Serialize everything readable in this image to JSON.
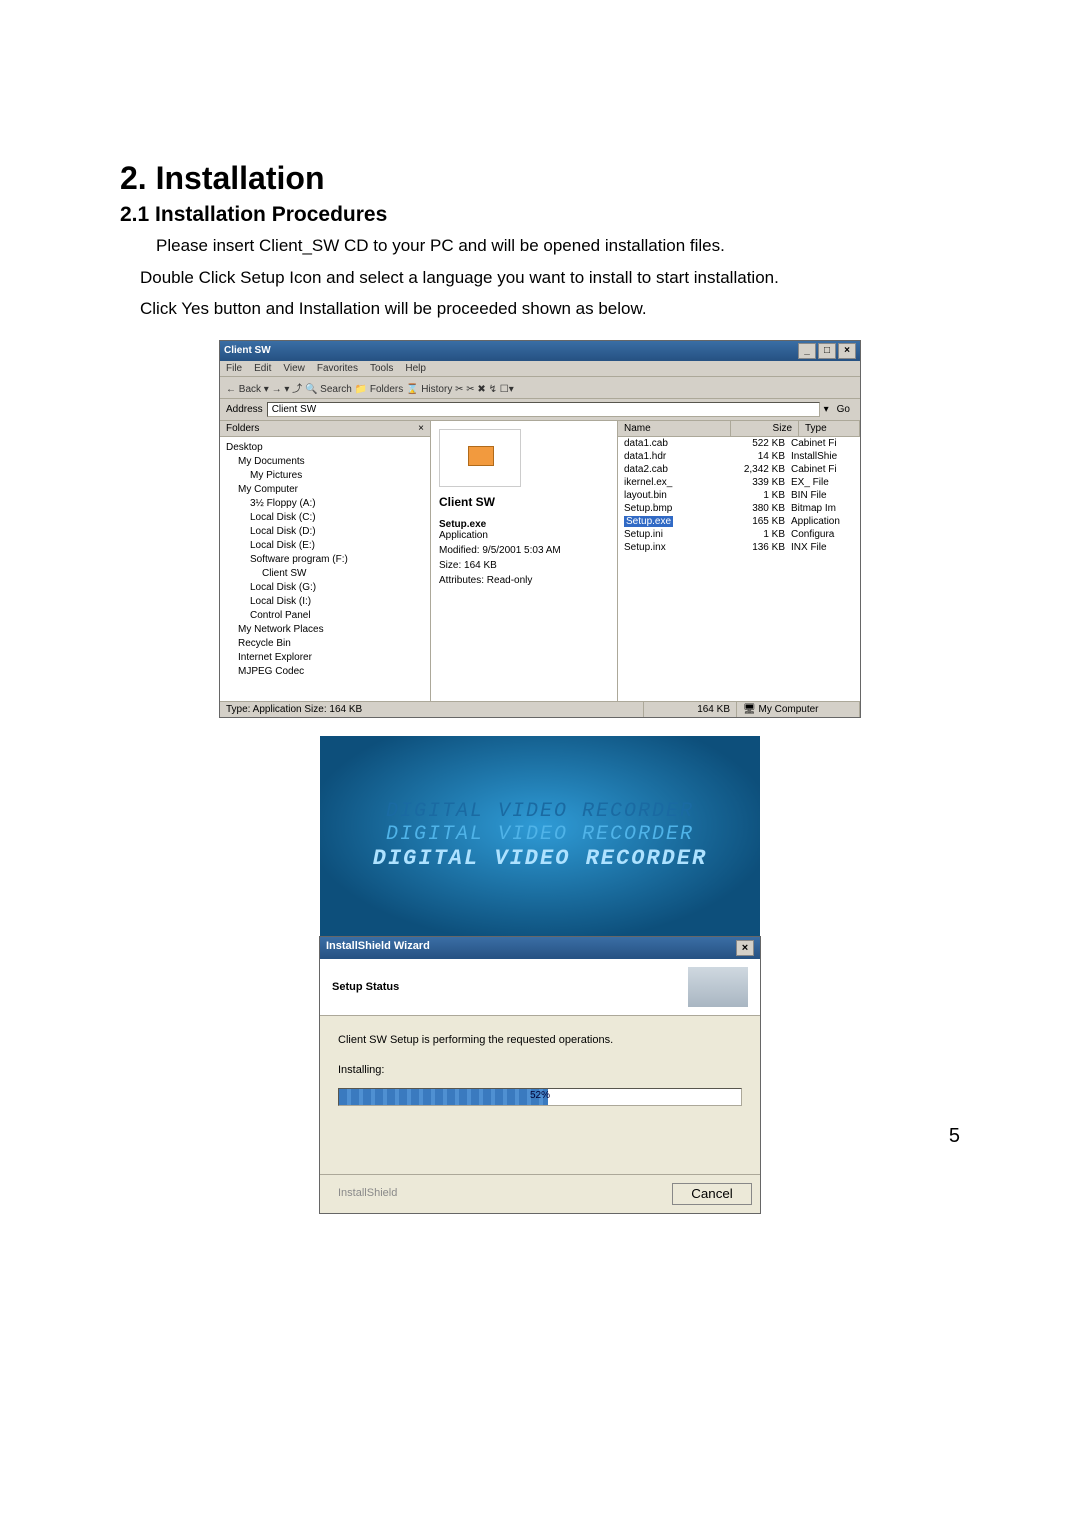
{
  "heading": "2. Installation",
  "subheading": "2.1 Installation Procedures",
  "para1": "Please insert Client_SW CD to your PC and will be opened installation files.",
  "para2": "Double Click Setup Icon and select a language you want to install to start installation.",
  "para3": "Click Yes button and Installation will be proceeded shown as below.",
  "page_number": "5",
  "explorer": {
    "title": "Client SW",
    "menu": [
      "File",
      "Edit",
      "View",
      "Favorites",
      "Tools",
      "Help"
    ],
    "toolbar": "← Back  ▾  →  ▾  ⤴   🔍 Search   📁 Folders   ⌛ History   ✂  ✂  ✖  ↯   ☐▾",
    "address_label": "Address",
    "address_value": "Client SW",
    "go": "Go",
    "folders_label": "Folders",
    "tree": [
      {
        "t": "Desktop",
        "i": 0
      },
      {
        "t": "My Documents",
        "i": 1
      },
      {
        "t": "My Pictures",
        "i": 2
      },
      {
        "t": "My Computer",
        "i": 1
      },
      {
        "t": "3½ Floppy (A:)",
        "i": 2
      },
      {
        "t": "Local Disk (C:)",
        "i": 2
      },
      {
        "t": "Local Disk (D:)",
        "i": 2
      },
      {
        "t": "Local Disk (E:)",
        "i": 2
      },
      {
        "t": "Software program (F:)",
        "i": 2
      },
      {
        "t": "Client SW",
        "i": 3
      },
      {
        "t": "Local Disk (G:)",
        "i": 2
      },
      {
        "t": "Local Disk (I:)",
        "i": 2
      },
      {
        "t": "Control Panel",
        "i": 2
      },
      {
        "t": "My Network Places",
        "i": 1
      },
      {
        "t": "Recycle Bin",
        "i": 1
      },
      {
        "t": "Internet Explorer",
        "i": 1
      },
      {
        "t": "MJPEG Codec",
        "i": 1
      }
    ],
    "preview": {
      "name": "Client SW",
      "line1_label": "Setup.exe",
      "line1_sub": "Application",
      "line2": "Modified: 9/5/2001 5:03 AM",
      "line3": "Size: 164 KB",
      "line4": "Attributes: Read-only"
    },
    "columns": [
      "Name",
      "Size",
      "Type"
    ],
    "files": [
      {
        "n": "data1.cab",
        "s": "522 KB",
        "t": "Cabinet Fi"
      },
      {
        "n": "data1.hdr",
        "s": "14 KB",
        "t": "InstallShie"
      },
      {
        "n": "data2.cab",
        "s": "2,342 KB",
        "t": "Cabinet Fi"
      },
      {
        "n": "ikernel.ex_",
        "s": "339 KB",
        "t": "EX_ File"
      },
      {
        "n": "layout.bin",
        "s": "1 KB",
        "t": "BIN File"
      },
      {
        "n": "Setup.bmp",
        "s": "380 KB",
        "t": "Bitmap Im"
      },
      {
        "n": "Setup.exe",
        "s": "165 KB",
        "t": "Application",
        "sel": true
      },
      {
        "n": "Setup.ini",
        "s": "1 KB",
        "t": "Configura"
      },
      {
        "n": "Setup.inx",
        "s": "136 KB",
        "t": "INX File"
      }
    ],
    "status_left": "Type: Application Size: 164 KB",
    "status_mid": "164 KB",
    "status_right": "My Computer"
  },
  "splash": {
    "l1": "DIGITAL VIDEO RECORDER",
    "l2": "DIGITAL VIDEO RECORDER",
    "l3": "DIGITAL VIDEO RECORDER"
  },
  "wizard": {
    "title": "InstallShield Wizard",
    "header": "Setup Status",
    "message": "Client SW Setup is performing the requested operations.",
    "label": "Installing:",
    "percent": "52%",
    "percent_bar_width": "52%",
    "footer_disabled": "InstallShield",
    "cancel": "Cancel"
  }
}
